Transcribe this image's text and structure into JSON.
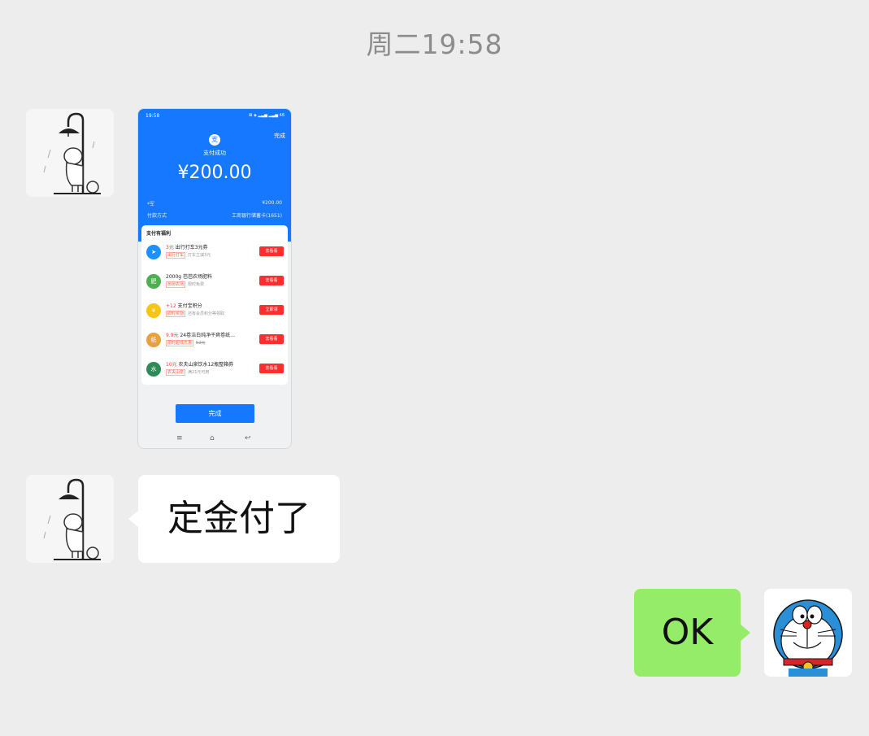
{
  "timestamp": "周二19:58",
  "messages": {
    "screenshot": {
      "status_time": "19:58",
      "status_icons": "⊠ ◈ ▂▃▅ ▂▃▅ 46",
      "top_done": "完成",
      "pay_icon": "支",
      "pay_status": "支付成功",
      "amount": "¥200.00",
      "rows": [
        {
          "label": "*军",
          "value": "¥200.00"
        },
        {
          "label": "付款方式",
          "value": "工商银行储蓄卡(1651)"
        }
      ],
      "benefits_title": "支付有福利",
      "benefits": [
        {
          "icon": "➤",
          "icon_color": "#1e90ff",
          "highlight": "3元",
          "title": " 出行打车3元券",
          "tag": "出行打车",
          "sub": "打车立减3元",
          "button": "去看看"
        },
        {
          "icon": "肥",
          "icon_color": "#4caf50",
          "highlight": "",
          "title": "2000g 芭芭农场肥料",
          "tag": "芭芭农场",
          "sub": "限时免费",
          "button": "去看看"
        },
        {
          "icon": "¥",
          "icon_color": "#f5c518",
          "highlight": "+12",
          "title": " 支付宝积分",
          "tag": "即时奖励",
          "sub": "还有会员积分等领取",
          "button": "立即领"
        },
        {
          "icon": "纸",
          "icon_color": "#e8a23c",
          "highlight": "9.9元",
          "title": " 24卷洁白纯净干爽卷纸…",
          "tag": "限时超低优惠",
          "sub": "52元",
          "button": "去看看"
        },
        {
          "icon": "水",
          "icon_color": "#2e8b57",
          "highlight": "10元",
          "title": " 农夫山泉饮水12瓶整箱券",
          "tag": "农夫山泉",
          "sub": "满21元可用",
          "button": "去看看"
        }
      ],
      "done_button": "完成",
      "nav": [
        "≡",
        "⌂",
        "↩"
      ]
    },
    "text_left": "定金付了",
    "text_right": "OK"
  },
  "avatars": {
    "left": "umbrella-sketch-avatar",
    "right": "doraemon-avatar"
  }
}
